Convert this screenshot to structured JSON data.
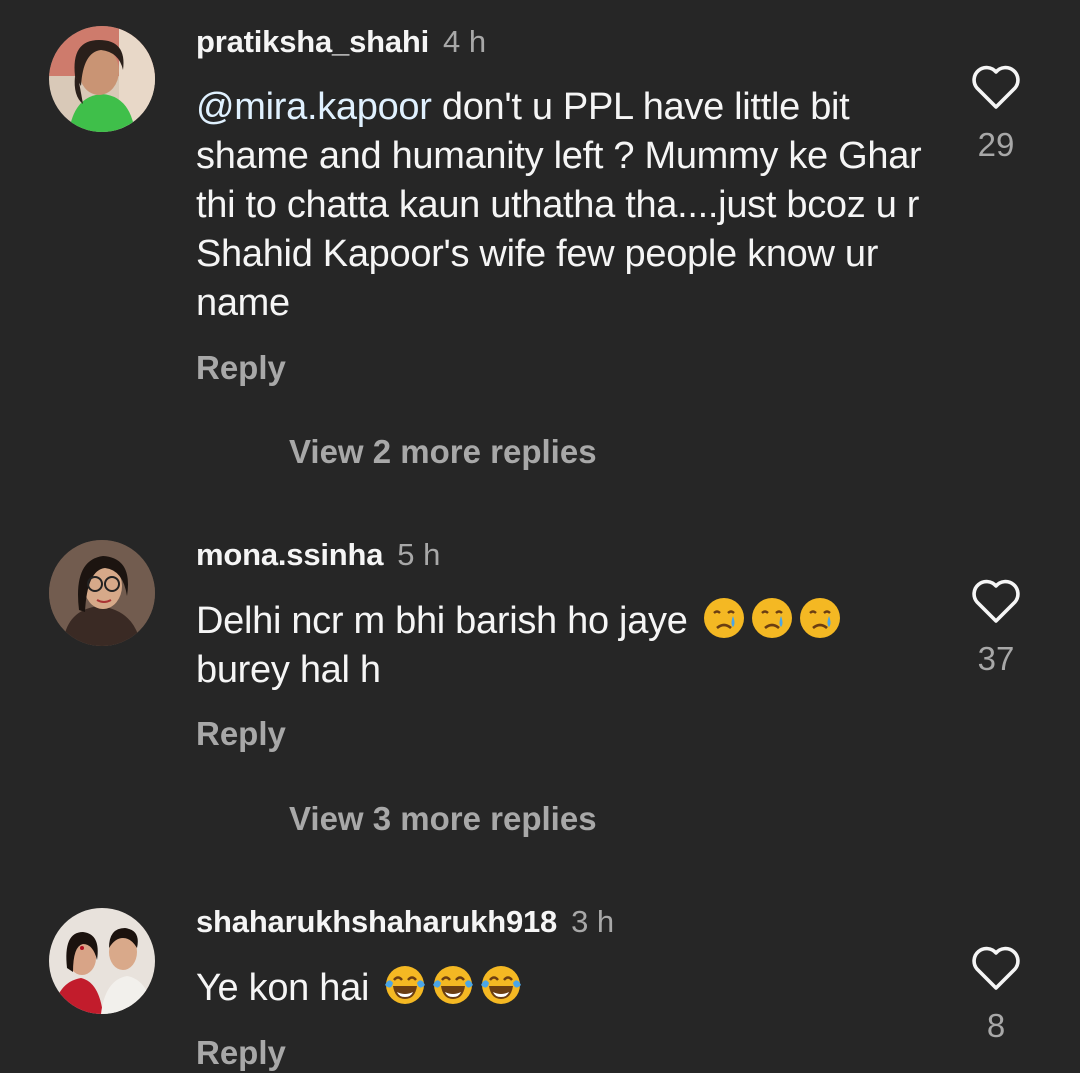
{
  "comments": [
    {
      "username": "pratiksha_shahi",
      "time": "4 h",
      "mention": "@mira.kapoor",
      "text": " don't u PPL have little bit shame and humanity left ? Mummy ke Ghar thi to chatta kaun uthatha tha....just bcoz u r Shahid Kapoor's wife few people know ur name",
      "reply_label": "Reply",
      "view_replies": "View 2 more replies",
      "likes": "29"
    },
    {
      "username": "mona.ssinha",
      "time": "5 h",
      "text_before": "Delhi ncr m bhi barish ho jaye ",
      "emoji_name": "crying-face-emoji",
      "emoji_count": 3,
      "text_after": "burey hal h",
      "reply_label": "Reply",
      "view_replies": "View 3 more replies",
      "likes": "37"
    },
    {
      "username": "shaharukhshaharukh918",
      "time": "3 h",
      "text_before": "Ye kon hai ",
      "emoji_name": "tears-of-joy-emoji",
      "emoji_count": 3,
      "reply_label": "Reply",
      "likes": "8"
    }
  ],
  "colors": {
    "background": "#262626",
    "primary_text": "#f5f5f5",
    "secondary_text": "#a8a8a8",
    "mention": "#e0f1ff"
  }
}
